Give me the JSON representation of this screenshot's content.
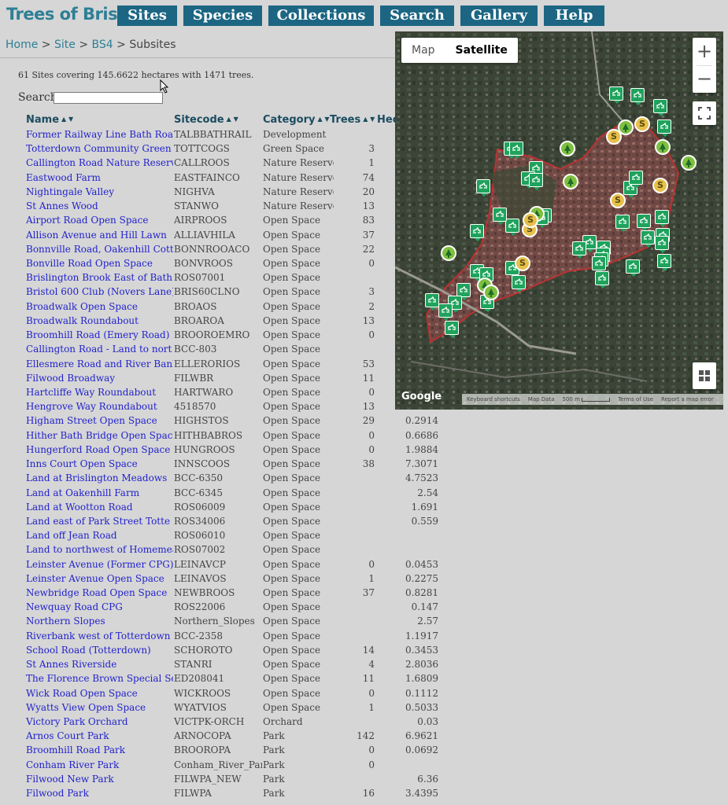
{
  "header": {
    "logo": "Trees of Bristol",
    "nav": [
      "Sites",
      "Species",
      "Collections",
      "Search",
      "Gallery",
      "Help"
    ]
  },
  "breadcrumb": {
    "home": "Home",
    "site": "Site",
    "bs4": "BS4",
    "current": "Subsites",
    "sep1": ">",
    "sep2": ">",
    "sep3": ">"
  },
  "summary": "61 Sites covering 145.6622 hectares with 1471 trees.",
  "search": {
    "label": "Search",
    "value": ""
  },
  "columns": {
    "name": "Name",
    "code": "Sitecode",
    "category": "Category",
    "trees": "Trees",
    "hectares": "Hec",
    "sort_glyphs": "▲ ▼"
  },
  "rows": [
    {
      "name": "Former Railway Line Bath Road/",
      "code": "TALBBATHRAIL",
      "category": "Development",
      "trees": "",
      "ha": ""
    },
    {
      "name": "Totterdown Community Green Spa",
      "code": "TOTTCOGS",
      "category": "Green Space",
      "trees": "3",
      "ha": ""
    },
    {
      "name": "Callington Road Nature Reserve",
      "code": "CALLROOS",
      "category": "Nature Reserve",
      "trees": "1",
      "ha": ""
    },
    {
      "name": "Eastwood Farm",
      "code": "EASTFAINCO",
      "category": "Nature Reserve",
      "trees": "74",
      "ha": ""
    },
    {
      "name": "Nightingale Valley",
      "code": "NIGHVA",
      "category": "Nature Reserve",
      "trees": "20",
      "ha": ""
    },
    {
      "name": "St Annes Wood",
      "code": "STANWO",
      "category": "Nature Reserve",
      "trees": "13",
      "ha": ""
    },
    {
      "name": "Airport Road Open Space",
      "code": "AIRPROOS",
      "category": "Open Space",
      "trees": "83",
      "ha": ""
    },
    {
      "name": "Allison Avenue and Hill Lawn",
      "code": "ALLIAVHILA",
      "category": "Open Space",
      "trees": "37",
      "ha": ""
    },
    {
      "name": "Bonnville Road, Oakenhill Cott",
      "code": "BONNROOACO",
      "category": "Open Space",
      "trees": "22",
      "ha": ""
    },
    {
      "name": "Bonville Road Open Space",
      "code": "BONVROOS",
      "category": "Open Space",
      "trees": "0",
      "ha": ""
    },
    {
      "name": "Brislington Brook East of Bath",
      "code": "ROS07001",
      "category": "Open Space",
      "trees": "",
      "ha": ""
    },
    {
      "name": "Bristol 600 Club (Novers Lane)",
      "code": "BRIS60CLNO",
      "category": "Open Space",
      "trees": "3",
      "ha": ""
    },
    {
      "name": "Broadwalk Open Space",
      "code": "BROAOS",
      "category": "Open Space",
      "trees": "2",
      "ha": ""
    },
    {
      "name": "Broadwalk Roundabout",
      "code": "BROAROA",
      "category": "Open Space",
      "trees": "13",
      "ha": ""
    },
    {
      "name": "Broomhill Road (Emery Road) R-",
      "code": "BROOROEMRO",
      "category": "Open Space",
      "trees": "0",
      "ha": ""
    },
    {
      "name": "Callington Road - Land to nort",
      "code": "BCC-803",
      "category": "Open Space",
      "trees": "",
      "ha": ""
    },
    {
      "name": "Ellesmere Road and River Bank",
      "code": "ELLERORIOS",
      "category": "Open Space",
      "trees": "53",
      "ha": ""
    },
    {
      "name": "Filwood Broadway",
      "code": "FILWBR",
      "category": "Open Space",
      "trees": "11",
      "ha": ""
    },
    {
      "name": "Hartcliffe Way Roundabout",
      "code": "HARTWARO",
      "category": "Open Space",
      "trees": "0",
      "ha": ""
    },
    {
      "name": "Hengrove Way Roundabout",
      "code": "4518570",
      "category": "Open Space",
      "trees": "13",
      "ha": ""
    },
    {
      "name": "Higham Street Open Space",
      "code": "HIGHSTOS",
      "category": "Open Space",
      "trees": "29",
      "ha": "0.2914"
    },
    {
      "name": "Hither Bath Bridge Open Space",
      "code": "HITHBABROS",
      "category": "Open Space",
      "trees": "0",
      "ha": "0.6686"
    },
    {
      "name": "Hungerford Road Open Space",
      "code": "HUNGROOS",
      "category": "Open Space",
      "trees": "0",
      "ha": "1.9884"
    },
    {
      "name": "Inns Court Open Space",
      "code": "INNSCOOS",
      "category": "Open Space",
      "trees": "38",
      "ha": "7.3071"
    },
    {
      "name": "Land at Brislington Meadows",
      "code": "BCC-6350",
      "category": "Open Space",
      "trees": "",
      "ha": "4.7523"
    },
    {
      "name": "Land at Oakenhill Farm",
      "code": "BCC-6345",
      "category": "Open Space",
      "trees": "",
      "ha": "2.54"
    },
    {
      "name": "Land at Wootton Road",
      "code": "ROS06009",
      "category": "Open Space",
      "trees": "",
      "ha": "1.691"
    },
    {
      "name": "Land east of Park Street Totte",
      "code": "ROS34006",
      "category": "Open Space",
      "trees": "",
      "ha": "0.559"
    },
    {
      "name": "Land off Jean Road",
      "code": "ROS06010",
      "category": "Open Space",
      "trees": "",
      "ha": ""
    },
    {
      "name": "Land to northwest of Homemead",
      "code": "ROS07002",
      "category": "Open Space",
      "trees": "",
      "ha": ""
    },
    {
      "name": "Leinster Avenue (Former CPG)",
      "code": "LEINAVCP",
      "category": "Open Space",
      "trees": "0",
      "ha": "0.0453"
    },
    {
      "name": "Leinster Avenue Open Space",
      "code": "LEINAVOS",
      "category": "Open Space",
      "trees": "1",
      "ha": "0.2275"
    },
    {
      "name": "Newbridge Road Open Space",
      "code": "NEWBROOS",
      "category": "Open Space",
      "trees": "37",
      "ha": "0.8281"
    },
    {
      "name": "Newquay Road CPG",
      "code": "ROS22006",
      "category": "Open Space",
      "trees": "",
      "ha": "0.147"
    },
    {
      "name": "Northern Slopes",
      "code": "Northern_Slopes",
      "category": "Open Space",
      "trees": "",
      "ha": "2.57"
    },
    {
      "name": "Riverbank west of Totterdown B",
      "code": "BCC-2358",
      "category": "Open Space",
      "trees": "",
      "ha": "1.1917"
    },
    {
      "name": "School Road (Totterdown)",
      "code": "SCHOROTO",
      "category": "Open Space",
      "trees": "14",
      "ha": "0.3453"
    },
    {
      "name": "St Annes Riverside",
      "code": "STANRI",
      "category": "Open Space",
      "trees": "4",
      "ha": "2.8036"
    },
    {
      "name": "The Florence Brown Special Sch",
      "code": "ED208041",
      "category": "Open Space",
      "trees": "11",
      "ha": "1.6809"
    },
    {
      "name": "Wick Road Open Space",
      "code": "WICKROOS",
      "category": "Open Space",
      "trees": "0",
      "ha": "0.1112"
    },
    {
      "name": "Wyatts View Open Space",
      "code": "WYATVIOS",
      "category": "Open Space",
      "trees": "1",
      "ha": "0.5033"
    },
    {
      "name": "Victory Park Orchard",
      "code": "VICTPK-ORCH",
      "category": "Orchard",
      "trees": "",
      "ha": "0.03"
    },
    {
      "name": "Arnos Court Park",
      "code": "ARNOCOPA",
      "category": "Park",
      "trees": "142",
      "ha": "6.9621"
    },
    {
      "name": "Broomhill Road Park",
      "code": "BROOROPA",
      "category": "Park",
      "trees": "0",
      "ha": "0.0692"
    },
    {
      "name": "Conham River Park",
      "code": "Conham_River_Park",
      "category": "Park",
      "trees": "0",
      "ha": ""
    },
    {
      "name": "Filwood New Park",
      "code": "FILWPA_NEW",
      "category": "Park",
      "trees": "",
      "ha": "6.36"
    },
    {
      "name": "Filwood Park",
      "code": "FILWPA",
      "category": "Park",
      "trees": "16",
      "ha": "3.4395"
    }
  ],
  "map": {
    "type_map": "Map",
    "type_satellite": "Satellite",
    "zoom_in": "+",
    "zoom_out": "−",
    "google": "Google",
    "attribution": [
      "Keyboard shortcuts",
      "Map Data",
      "500 m",
      "Terms of Use",
      "Report a map error"
    ],
    "marker_s": "S"
  },
  "colors": {
    "nav_bg": "#1c6683",
    "logo": "#2e7f95",
    "link": "#2222cc",
    "marker_green": "#1fa35c",
    "tree_marker": "#7fbf3f",
    "s_marker": "#e6c04a"
  }
}
